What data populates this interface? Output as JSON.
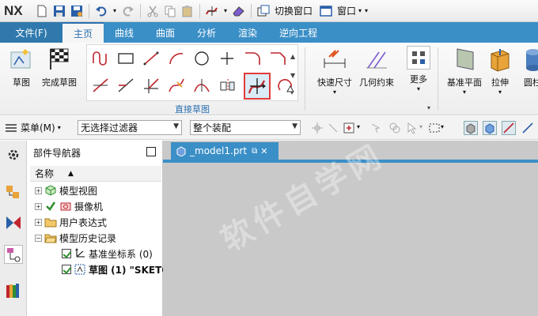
{
  "app": {
    "logo": "NX"
  },
  "titlebar": {
    "switch_window": "切换窗口",
    "window_menu": "窗口"
  },
  "tabs": {
    "file": "文件(F)",
    "items": [
      "主页",
      "曲线",
      "曲面",
      "分析",
      "渲染",
      "逆向工程"
    ],
    "active": "主页"
  },
  "ribbon": {
    "sketch": "草图",
    "finish_sketch": "完成草图",
    "group_label": "直接草图",
    "rapid_dimension": "快速尺寸",
    "geometric_constraints": "几何约束",
    "more": "更多",
    "datum_plane": "基准平面",
    "extrude": "拉伸",
    "cylinder": "圆柱"
  },
  "selbar": {
    "menu": "菜单(M)",
    "filter": "无选择过滤器",
    "scope": "整个装配"
  },
  "navigator": {
    "title": "部件导航器",
    "column_name": "名称",
    "rows": [
      {
        "label": "模型视图"
      },
      {
        "label": "摄像机"
      },
      {
        "label": "用户表达式"
      },
      {
        "label": "模型历史记录"
      },
      {
        "label": "基准坐标系 (0)"
      },
      {
        "label": "草图 (1) \"SKETC"
      }
    ]
  },
  "graphics": {
    "doc_tab": "_model1.prt",
    "watermark": "软件自学网"
  },
  "colors": {
    "ribbon_blue": "#3b8fc7",
    "highlight_red": "#e23b3b",
    "viewport_gray": "#c9c9c9"
  }
}
